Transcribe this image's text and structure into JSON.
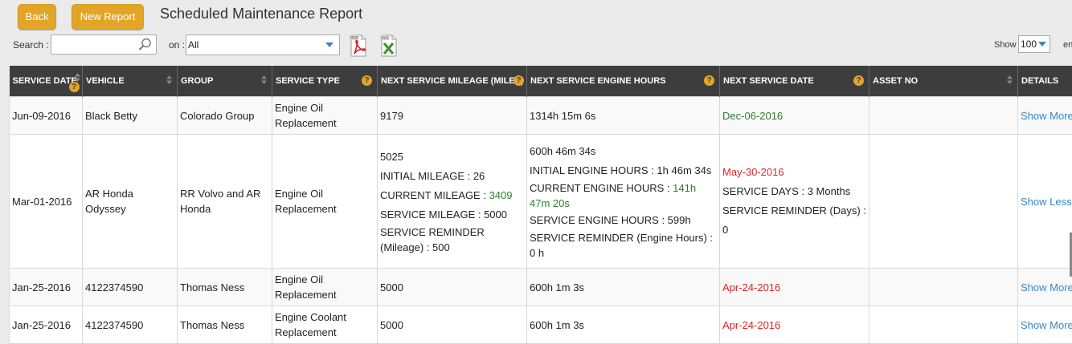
{
  "toolbar": {
    "back_label": "Back",
    "new_report_label": "New Report"
  },
  "page_title": "Scheduled Maintenance Report",
  "search": {
    "label": "Search :",
    "value": ""
  },
  "on_label": "on :",
  "filter": {
    "selected": "All"
  },
  "export": {
    "pdf_icon": "pdf-icon",
    "xls_icon": "xls-icon"
  },
  "show": {
    "label": "Show",
    "value": "100",
    "suffix": "entri"
  },
  "columns": [
    "SERVICE DATE",
    "VEHICLE",
    "GROUP",
    "SERVICE TYPE",
    "NEXT SERVICE MILEAGE (MILES)",
    "NEXT SERVICE ENGINE HOURS",
    "NEXT SERVICE DATE",
    "ASSET NO",
    "DETAILS"
  ],
  "rows": [
    {
      "service_date": "Jun-09-2016",
      "vehicle": "Black Betty",
      "group": "Colorado Group",
      "service_type": "Engine Oil Replacement",
      "mileage": "9179",
      "engine_hours": "1314h 15m 6s",
      "next_date": "Dec-06-2016",
      "asset": "",
      "details": "Show More"
    },
    {
      "service_date": "Mar-01-2016",
      "vehicle": "AR Honda Odyssey",
      "group": "RR Volvo and AR Honda",
      "service_type": "Engine Oil Replacement",
      "mileage": "5025",
      "initial_mileage_label": "INITIAL MILEAGE : 26",
      "current_mileage_label": "CURRENT MILEAGE : ",
      "current_mileage_value": "3409",
      "service_mileage_label": "SERVICE MILEAGE : 5000",
      "service_reminder_mileage": "SERVICE REMINDER (Mileage) : 500",
      "engine_hours": "600h 46m 34s",
      "initial_engine_hours": "INITIAL ENGINE HOURS : 1h 46m 34s",
      "current_engine_hours_label": "CURRENT ENGINE HOURS : ",
      "current_engine_hours_value": "141h 47m 20s",
      "service_engine_hours": "SERVICE ENGINE HOURS : 599h",
      "service_reminder_engine": "SERVICE REMINDER (Engine Hours) : 0 h",
      "next_date": "May-30-2016",
      "service_days": "SERVICE DAYS : 3 Months",
      "service_reminder_days": "SERVICE REMINDER (Days) : 0",
      "asset": "",
      "details": "Show Less"
    },
    {
      "service_date": "Jan-25-2016",
      "vehicle": "4122374590",
      "group": "Thomas Ness",
      "service_type": "Engine Oil Replacement",
      "mileage": "5000",
      "engine_hours": "600h 1m 3s",
      "next_date": "Apr-24-2016",
      "asset": "",
      "details": "Show More"
    },
    {
      "service_date": "Jan-25-2016",
      "vehicle": "4122374590",
      "group": "Thomas Ness",
      "service_type": "Engine Coolant Replacement",
      "mileage": "5000",
      "engine_hours": "600h 1m 3s",
      "next_date": "Apr-24-2016",
      "asset": "",
      "details": "Show More"
    }
  ],
  "colors": {
    "accent": "#e3a528",
    "header_bg": "#3d3d3d",
    "link": "#3a86c8",
    "green": "#2e7d2e",
    "red": "#e02424"
  }
}
